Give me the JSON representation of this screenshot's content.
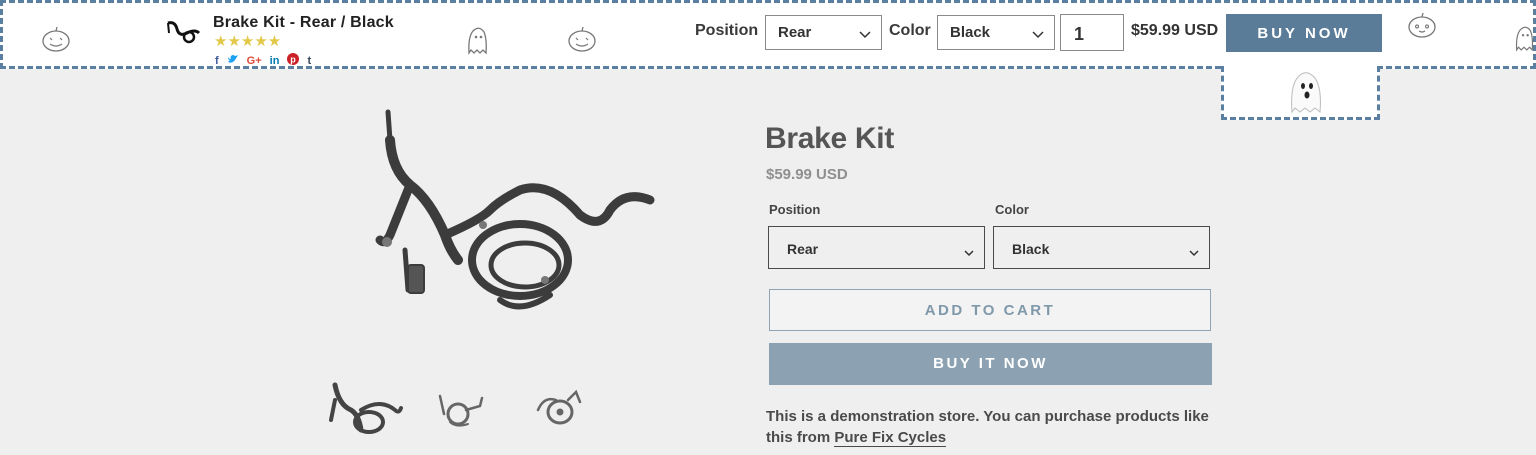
{
  "sticky_bar": {
    "product_title": "Brake Kit - Rear / Black",
    "rating_stars": "★★★★★",
    "rating_value": 5,
    "social_icons": [
      "facebook-icon",
      "twitter-icon",
      "google-plus-icon",
      "linkedin-icon",
      "pinterest-icon",
      "tumblr-icon"
    ],
    "social_glyphs": [
      "f",
      "🐦",
      "G+",
      "in",
      "p",
      "t"
    ],
    "position_label": "Position",
    "position_value": "Rear",
    "color_label": "Color",
    "color_value": "Black",
    "quantity": "1",
    "price": "$59.99 USD",
    "buy_label": "BUY NOW"
  },
  "product": {
    "title": "Brake Kit",
    "price": "$59.99 USD",
    "position_label": "Position",
    "position_value": "Rear",
    "color_label": "Color",
    "color_value": "Black",
    "add_to_cart": "ADD TO CART",
    "buy_it_now": "BUY IT NOW",
    "description": "This is a demonstration store. You can purchase products like this from ",
    "description_link": "Pure Fix Cycles"
  },
  "colors": {
    "accent": "#5a7c99",
    "buy_it_now_bg": "#8ca2b2",
    "star": "#e2c94a",
    "facebook": "#3b5998",
    "twitter": "#1da1f2",
    "google": "#dd4b39",
    "linkedin": "#0077b5",
    "pinterest": "#cb2027",
    "tumblr": "#35465c"
  }
}
